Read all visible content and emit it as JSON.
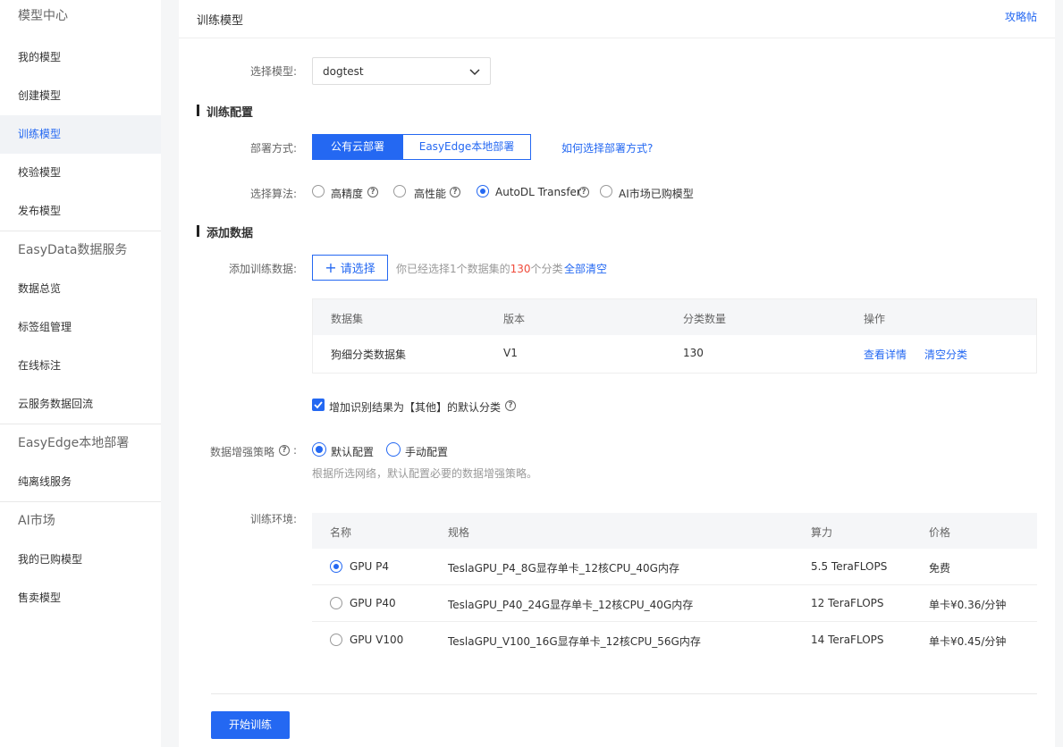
{
  "sidebar": {
    "groups": [
      {
        "title": "模型中心",
        "items": [
          "我的模型",
          "创建模型",
          "训练模型",
          "校验模型",
          "发布模型"
        ]
      },
      {
        "title": "EasyData数据服务",
        "items": [
          "数据总览",
          "标签组管理",
          "在线标注",
          "云服务数据回流"
        ]
      },
      {
        "title": "EasyEdge本地部署",
        "items": [
          "纯离线服务"
        ]
      },
      {
        "title": "AI市场",
        "items": [
          "我的已购模型",
          "售卖模型"
        ]
      }
    ],
    "active_item": "训练模型"
  },
  "header": {
    "title": "训练模型",
    "guide_link": "攻略帖"
  },
  "model_select": {
    "label": "选择模型:",
    "value": "dogtest"
  },
  "train_config": {
    "section_title": "训练配置",
    "deploy_label": "部署方式:",
    "deploy_options": [
      "公有云部署",
      "EasyEdge本地部署"
    ],
    "deploy_selected": "公有云部署",
    "deploy_help_link": "如何选择部署方式?",
    "algo_label": "选择算法:",
    "algo_options": [
      "高精度",
      "高性能",
      "AutoDL Transfer",
      "AI市场已购模型"
    ],
    "algo_selected": "AutoDL Transfer"
  },
  "add_data": {
    "section_title": "添加数据",
    "label": "添加训练数据:",
    "select_button": "请选择",
    "summary_prefix": "你已经选择1个数据集的",
    "summary_count": "130",
    "summary_suffix": "个分类",
    "clear_all": "全部清空",
    "table": {
      "headers": [
        "数据集",
        "版本",
        "分类数量",
        "操作"
      ],
      "rows": [
        {
          "dataset": "狗细分类数据集",
          "version": "V1",
          "count": "130",
          "actions": [
            "查看详情",
            "清空分类"
          ]
        }
      ]
    },
    "default_class_checkbox": {
      "label": "增加识别结果为【其他】的默认分类",
      "checked": true
    }
  },
  "augment": {
    "label": "数据增强策略",
    "colon": ":",
    "options": [
      "默认配置",
      "手动配置"
    ],
    "selected": "默认配置",
    "hint": "根据所选网络，默认配置必要的数据增强策略。"
  },
  "env": {
    "label": "训练环境:",
    "headers": [
      "名称",
      "规格",
      "算力",
      "价格"
    ],
    "rows": [
      {
        "name": "GPU P4",
        "spec": "TeslaGPU_P4_8G显存单卡_12核CPU_40G内存",
        "power": "5.5 TeraFLOPS",
        "price": "免费",
        "selected": true
      },
      {
        "name": "GPU P40",
        "spec": "TeslaGPU_P40_24G显存单卡_12核CPU_40G内存",
        "power": "12 TeraFLOPS",
        "price": "单卡¥0.36/分钟",
        "selected": false
      },
      {
        "name": "GPU V100",
        "spec": "TeslaGPU_V100_16G显存单卡_12核CPU_56G内存",
        "power": "14 TeraFLOPS",
        "price": "单卡¥0.45/分钟",
        "selected": false
      }
    ]
  },
  "start_button": "开始训练",
  "colors": {
    "accent": "#2468f2",
    "danger": "#f04b3b"
  }
}
